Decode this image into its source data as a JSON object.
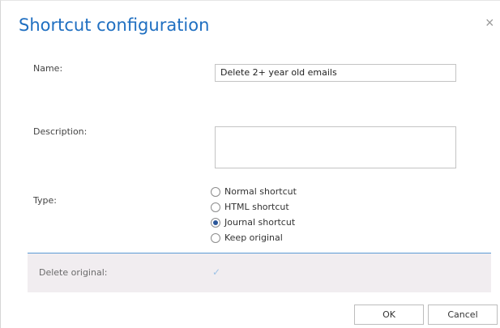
{
  "dialog": {
    "title": "Shortcut configuration",
    "close_glyph": "×"
  },
  "form": {
    "name_label": "Name:",
    "name_value": "Delete  2+ year old emails",
    "description_label": "Description:",
    "description_value": "",
    "type_label": "Type:",
    "type_options": [
      {
        "label": "Normal shortcut",
        "checked": false
      },
      {
        "label": "HTML shortcut",
        "checked": false
      },
      {
        "label": "Journal shortcut",
        "checked": true
      },
      {
        "label": "Keep original",
        "checked": false
      }
    ],
    "delete_original_label": "Delete original:",
    "delete_original_checked": true,
    "check_glyph": "✓"
  },
  "buttons": {
    "ok_label": "OK",
    "cancel_label": "Cancel"
  },
  "colors": {
    "title": "#1f6fc1",
    "accent_line": "#5b9bd5",
    "panel_bg": "#f1edf0"
  }
}
